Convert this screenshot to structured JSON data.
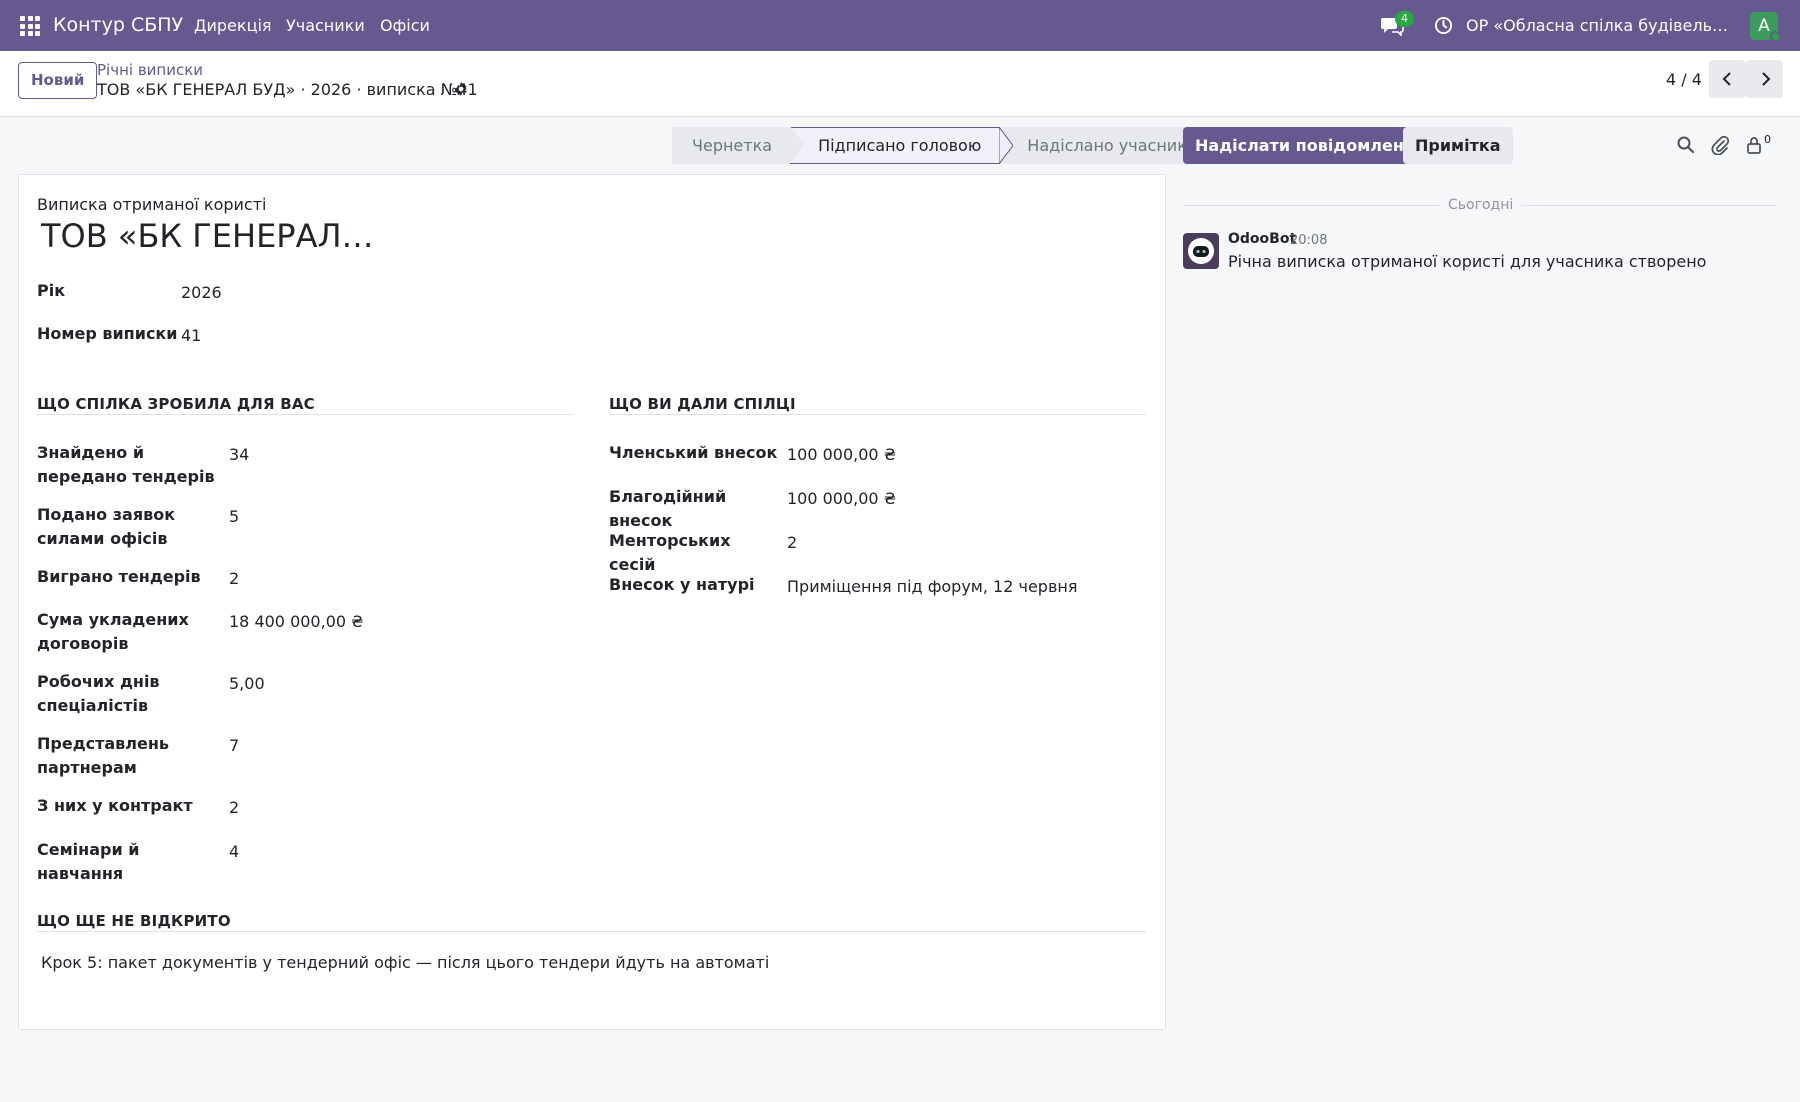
{
  "navbar": {
    "brand": "Контур СБПУ",
    "menu": [
      "Дирекція",
      "Учасники",
      "Офіси"
    ],
    "chat_badge": "4",
    "company": "ОР «Обласна спілка будівельників»",
    "avatar_letter": "A",
    "accent": "#65598f"
  },
  "control": {
    "new_button": "Новий",
    "breadcrumb_parent": "Річні виписки",
    "breadcrumb_current": "ТОВ «БК ГЕНЕРАЛ БУД» · 2026 · виписка №41",
    "pager": "4 / 4"
  },
  "statusbar": {
    "stages": [
      "Чернетка",
      "Підписано головою",
      "Надіслано учаснику"
    ],
    "active_stage": "Підписано головою"
  },
  "form": {
    "doc_type": "Виписка отриманої користі",
    "title": "ТОВ «БК ГЕНЕРАЛ БУД»",
    "year_label": "Рік",
    "year_value": "2026",
    "number_label": "Номер виписки",
    "number_value": "41",
    "left_section": {
      "title": "ЩО СПІЛКА ЗРОБИЛА ДЛЯ ВАС",
      "rows": [
        {
          "label": "Знайдено й передано тендерів",
          "value": "34"
        },
        {
          "label": "Подано заявок силами офісів",
          "value": "5"
        },
        {
          "label": "Виграно тендерів",
          "value": "2"
        },
        {
          "label": "Сума укладених договорів",
          "value": "18 400 000,00 ₴"
        },
        {
          "label": "Робочих днів спеціалістів",
          "value": "5,00"
        },
        {
          "label": "Представлень партнерам",
          "value": "7"
        },
        {
          "label": "З них у контракт",
          "value": "2"
        },
        {
          "label": "Семінари й навчання",
          "value": "4"
        }
      ]
    },
    "right_section": {
      "title": "ЩО ВИ ДАЛИ СПІЛЦІ",
      "rows": [
        {
          "label": "Членський внесок",
          "value": "100 000,00 ₴"
        },
        {
          "label": "Благодійний внесок",
          "value": "100 000,00 ₴"
        },
        {
          "label": "Менторських сесій",
          "value": "2"
        },
        {
          "label": "Внесок у натурі",
          "value": "Приміщення під форум, 12 червня"
        }
      ]
    },
    "not_opened": {
      "title": "ЩО ЩЕ НЕ ВІДКРИТО",
      "text": "Крок 5: пакет документів у тендерний офіс — після цього тендери йдуть на автоматі"
    }
  },
  "chatter": {
    "send_message": "Надіслати повідомлення",
    "log_note": "Примітка",
    "followers_count": "0",
    "separator": "Сьогодні",
    "message": {
      "author": "OdooBot",
      "time": "20:08",
      "body": "Річна виписка отриманої користі для учасника створено"
    }
  }
}
